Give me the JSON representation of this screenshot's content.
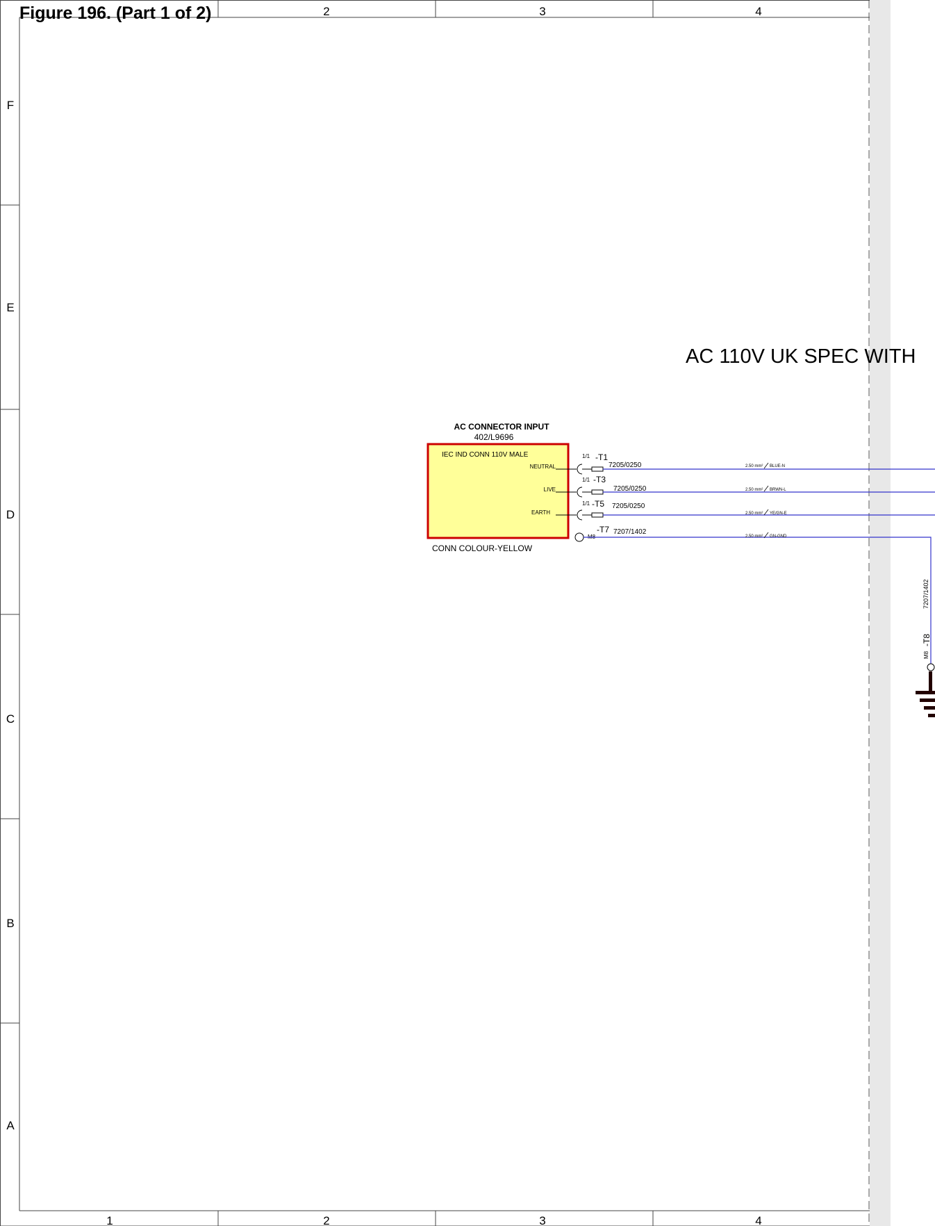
{
  "figure_title": "Figure 196. (Part 1 of 2)",
  "diagram_title": "AC 110V UK SPEC WITH",
  "columns_top": [
    "2",
    "3",
    "4"
  ],
  "columns_bottom": [
    "1",
    "2",
    "3",
    "4"
  ],
  "rows": [
    "F",
    "E",
    "D",
    "C",
    "B",
    "A"
  ],
  "connector": {
    "title": "AC CONNECTOR INPUT",
    "part_number": "402/L9696",
    "type": "IEC IND CONN 110V MALE",
    "colour_note": "CONN COLOUR-YELLOW",
    "box_fill": "#ffff99",
    "box_border": "#cc0000",
    "pins": [
      {
        "name": "NEUTRAL",
        "ratio": "1/1",
        "terminal": "-T1",
        "part": "7205/0250",
        "wire_size": "2.50 mm²",
        "wire_colour": "BLUE-N"
      },
      {
        "name": "LIVE",
        "ratio": "1/1",
        "terminal": "-T3",
        "part": "7205/0250",
        "wire_size": "2.50 mm²",
        "wire_colour": "BRWN-L"
      },
      {
        "name": "EARTH",
        "ratio": "1/1",
        "terminal": "-T5",
        "part": "7205/0250",
        "wire_size": "2.50 mm²",
        "wire_colour": "YE/GN-E"
      }
    ],
    "ground_lead": {
      "stud": "M8",
      "terminal": "-T7",
      "part": "7207/1402",
      "wire_size": "2.50 mm²",
      "wire_colour": "GN-GND"
    }
  },
  "vertical_lead": {
    "part": "7207/1402",
    "stud": "M8",
    "terminal": "-T8"
  },
  "colors": {
    "wire": "#3333cc",
    "grid": "#444444",
    "page_edge_shade": "#e8e8e8",
    "ground_symbol": "#220000"
  }
}
